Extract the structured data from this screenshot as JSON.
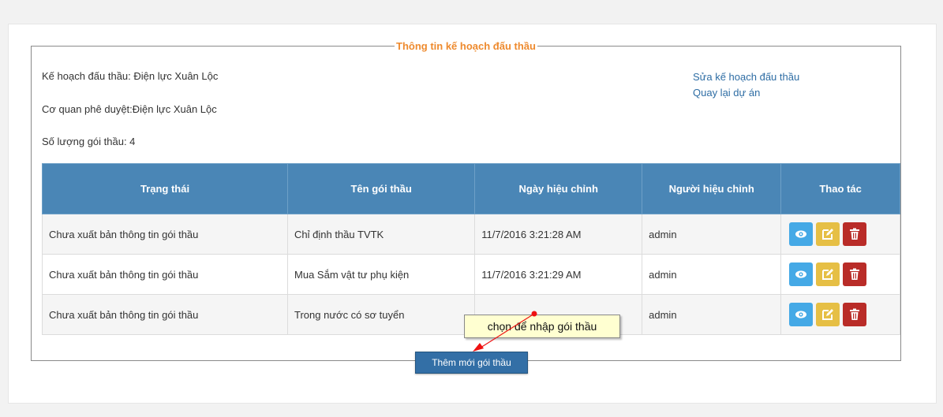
{
  "section_title": "Thông tin kế hoạch đấu thầu",
  "info": {
    "plan": "Kế hoạch đấu thầu: Điện lực Xuân Lộc",
    "approver": "Cơ quan phê duyệt:Điện lực Xuân Lộc",
    "count": "Số lượng gói thầu:  4"
  },
  "links": {
    "edit_plan": "Sửa kế hoạch đấu thầu",
    "back": "Quay lại dự án"
  },
  "table": {
    "headers": [
      "Trạng thái",
      "Tên gói thầu",
      "Ngày hiệu chỉnh",
      "Người hiệu chỉnh",
      "Thao tác"
    ],
    "rows": [
      [
        "Chưa xuất bản thông tin gói thầu",
        "Chỉ định thầu TVTK",
        "11/7/2016 3:21:28 AM",
        "admin"
      ],
      [
        "Chưa xuất bản thông tin gói thầu",
        "Mua Sắm vật tư phụ kiện",
        "11/7/2016 3:21:29 AM",
        "admin"
      ],
      [
        "Chưa xuất bản thông tin gói thầu",
        "Trong nước có sơ tuyển",
        "",
        "admin"
      ]
    ],
    "action_icons": [
      "eye-icon",
      "edit-icon",
      "trash-icon"
    ]
  },
  "add_button": "Thêm mới gói thầu",
  "tooltip": "chọn để nhập gói thầu",
  "colors": {
    "header_bg": "#4a86b6",
    "legend": "#ee8a2e",
    "view_btn": "#45a9e6",
    "edit_btn": "#e6bf45",
    "delete_btn": "#b92c28",
    "add_btn": "#336fa6"
  }
}
